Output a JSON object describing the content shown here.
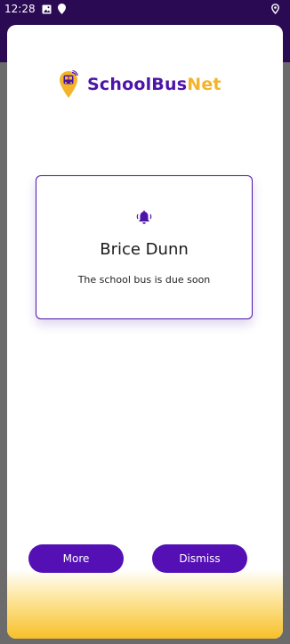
{
  "status_bar": {
    "time": "12:28",
    "left_icons": [
      "image-icon",
      "location-pin-icon"
    ],
    "right_icons": [
      "location-outline-icon"
    ]
  },
  "brand": {
    "name_part1": "SchoolBus",
    "name_part2": "Net",
    "logo_icon": "school-bus-pin-icon",
    "colors": {
      "primary": "#4d14a8",
      "accent": "#f4b42a"
    }
  },
  "notification": {
    "icon": "bell-icon",
    "title": "Brice Dunn",
    "message": "The school bus is due soon"
  },
  "actions": {
    "more_label": "More",
    "dismiss_label": "Dismiss"
  }
}
